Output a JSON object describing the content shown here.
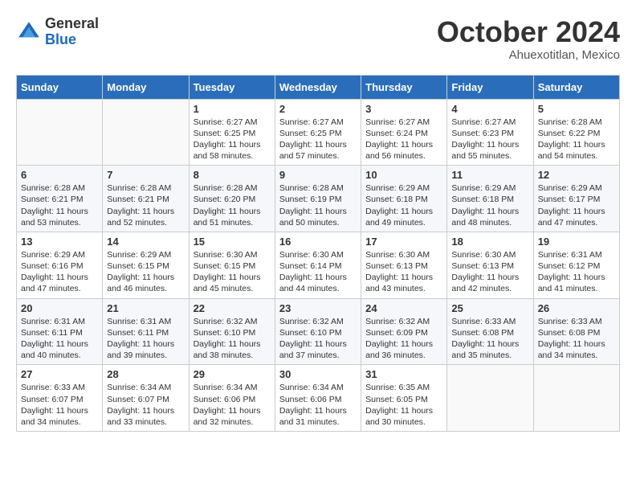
{
  "logo": {
    "line1": "General",
    "line2": "Blue"
  },
  "title": "October 2024",
  "location": "Ahuexotitlan, Mexico",
  "days_of_week": [
    "Sunday",
    "Monday",
    "Tuesday",
    "Wednesday",
    "Thursday",
    "Friday",
    "Saturday"
  ],
  "weeks": [
    [
      {
        "day": "",
        "info": ""
      },
      {
        "day": "",
        "info": ""
      },
      {
        "day": "1",
        "info": "Sunrise: 6:27 AM\nSunset: 6:25 PM\nDaylight: 11 hours and 58 minutes."
      },
      {
        "day": "2",
        "info": "Sunrise: 6:27 AM\nSunset: 6:25 PM\nDaylight: 11 hours and 57 minutes."
      },
      {
        "day": "3",
        "info": "Sunrise: 6:27 AM\nSunset: 6:24 PM\nDaylight: 11 hours and 56 minutes."
      },
      {
        "day": "4",
        "info": "Sunrise: 6:27 AM\nSunset: 6:23 PM\nDaylight: 11 hours and 55 minutes."
      },
      {
        "day": "5",
        "info": "Sunrise: 6:28 AM\nSunset: 6:22 PM\nDaylight: 11 hours and 54 minutes."
      }
    ],
    [
      {
        "day": "6",
        "info": "Sunrise: 6:28 AM\nSunset: 6:21 PM\nDaylight: 11 hours and 53 minutes."
      },
      {
        "day": "7",
        "info": "Sunrise: 6:28 AM\nSunset: 6:21 PM\nDaylight: 11 hours and 52 minutes."
      },
      {
        "day": "8",
        "info": "Sunrise: 6:28 AM\nSunset: 6:20 PM\nDaylight: 11 hours and 51 minutes."
      },
      {
        "day": "9",
        "info": "Sunrise: 6:28 AM\nSunset: 6:19 PM\nDaylight: 11 hours and 50 minutes."
      },
      {
        "day": "10",
        "info": "Sunrise: 6:29 AM\nSunset: 6:18 PM\nDaylight: 11 hours and 49 minutes."
      },
      {
        "day": "11",
        "info": "Sunrise: 6:29 AM\nSunset: 6:18 PM\nDaylight: 11 hours and 48 minutes."
      },
      {
        "day": "12",
        "info": "Sunrise: 6:29 AM\nSunset: 6:17 PM\nDaylight: 11 hours and 47 minutes."
      }
    ],
    [
      {
        "day": "13",
        "info": "Sunrise: 6:29 AM\nSunset: 6:16 PM\nDaylight: 11 hours and 47 minutes."
      },
      {
        "day": "14",
        "info": "Sunrise: 6:29 AM\nSunset: 6:15 PM\nDaylight: 11 hours and 46 minutes."
      },
      {
        "day": "15",
        "info": "Sunrise: 6:30 AM\nSunset: 6:15 PM\nDaylight: 11 hours and 45 minutes."
      },
      {
        "day": "16",
        "info": "Sunrise: 6:30 AM\nSunset: 6:14 PM\nDaylight: 11 hours and 44 minutes."
      },
      {
        "day": "17",
        "info": "Sunrise: 6:30 AM\nSunset: 6:13 PM\nDaylight: 11 hours and 43 minutes."
      },
      {
        "day": "18",
        "info": "Sunrise: 6:30 AM\nSunset: 6:13 PM\nDaylight: 11 hours and 42 minutes."
      },
      {
        "day": "19",
        "info": "Sunrise: 6:31 AM\nSunset: 6:12 PM\nDaylight: 11 hours and 41 minutes."
      }
    ],
    [
      {
        "day": "20",
        "info": "Sunrise: 6:31 AM\nSunset: 6:11 PM\nDaylight: 11 hours and 40 minutes."
      },
      {
        "day": "21",
        "info": "Sunrise: 6:31 AM\nSunset: 6:11 PM\nDaylight: 11 hours and 39 minutes."
      },
      {
        "day": "22",
        "info": "Sunrise: 6:32 AM\nSunset: 6:10 PM\nDaylight: 11 hours and 38 minutes."
      },
      {
        "day": "23",
        "info": "Sunrise: 6:32 AM\nSunset: 6:10 PM\nDaylight: 11 hours and 37 minutes."
      },
      {
        "day": "24",
        "info": "Sunrise: 6:32 AM\nSunset: 6:09 PM\nDaylight: 11 hours and 36 minutes."
      },
      {
        "day": "25",
        "info": "Sunrise: 6:33 AM\nSunset: 6:08 PM\nDaylight: 11 hours and 35 minutes."
      },
      {
        "day": "26",
        "info": "Sunrise: 6:33 AM\nSunset: 6:08 PM\nDaylight: 11 hours and 34 minutes."
      }
    ],
    [
      {
        "day": "27",
        "info": "Sunrise: 6:33 AM\nSunset: 6:07 PM\nDaylight: 11 hours and 34 minutes."
      },
      {
        "day": "28",
        "info": "Sunrise: 6:34 AM\nSunset: 6:07 PM\nDaylight: 11 hours and 33 minutes."
      },
      {
        "day": "29",
        "info": "Sunrise: 6:34 AM\nSunset: 6:06 PM\nDaylight: 11 hours and 32 minutes."
      },
      {
        "day": "30",
        "info": "Sunrise: 6:34 AM\nSunset: 6:06 PM\nDaylight: 11 hours and 31 minutes."
      },
      {
        "day": "31",
        "info": "Sunrise: 6:35 AM\nSunset: 6:05 PM\nDaylight: 11 hours and 30 minutes."
      },
      {
        "day": "",
        "info": ""
      },
      {
        "day": "",
        "info": ""
      }
    ]
  ]
}
